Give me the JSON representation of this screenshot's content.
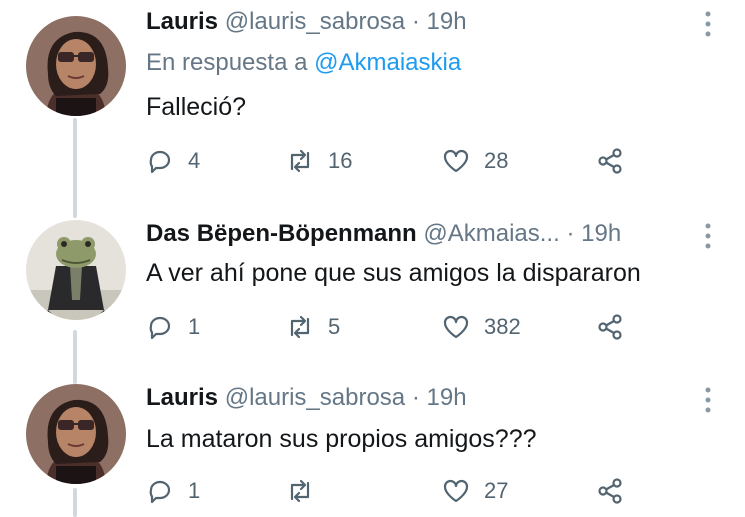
{
  "tweets": [
    {
      "name": "Lauris",
      "handle": "@lauris_sabrosa",
      "separator": "·",
      "time": "19h",
      "reply_prefix": "En respuesta a",
      "reply_mention": "@Akmaiaskia",
      "text": "Falleció?",
      "replies": "4",
      "retweets": "16",
      "likes": "28",
      "avatar_icon": "woman-sunglasses-avatar"
    },
    {
      "name": "Das Bëpen-Böpenmann",
      "handle": "@Akmaias...",
      "separator": "·",
      "time": "19h",
      "text": "A ver ahí pone que sus amigos la dispararon",
      "replies": "1",
      "retweets": "5",
      "likes": "382",
      "avatar_icon": "frog-in-jacket-avatar"
    },
    {
      "name": "Lauris",
      "handle": "@lauris_sabrosa",
      "separator": "·",
      "time": "19h",
      "text": "La mataron sus propios amigos???",
      "replies": "1",
      "retweets": "",
      "likes": "27",
      "avatar_icon": "woman-sunglasses-avatar"
    }
  ],
  "colors": {
    "text": "#14171a",
    "secondary": "#657786",
    "link": "#1d9bf0",
    "thread_line": "#cfd9de"
  }
}
